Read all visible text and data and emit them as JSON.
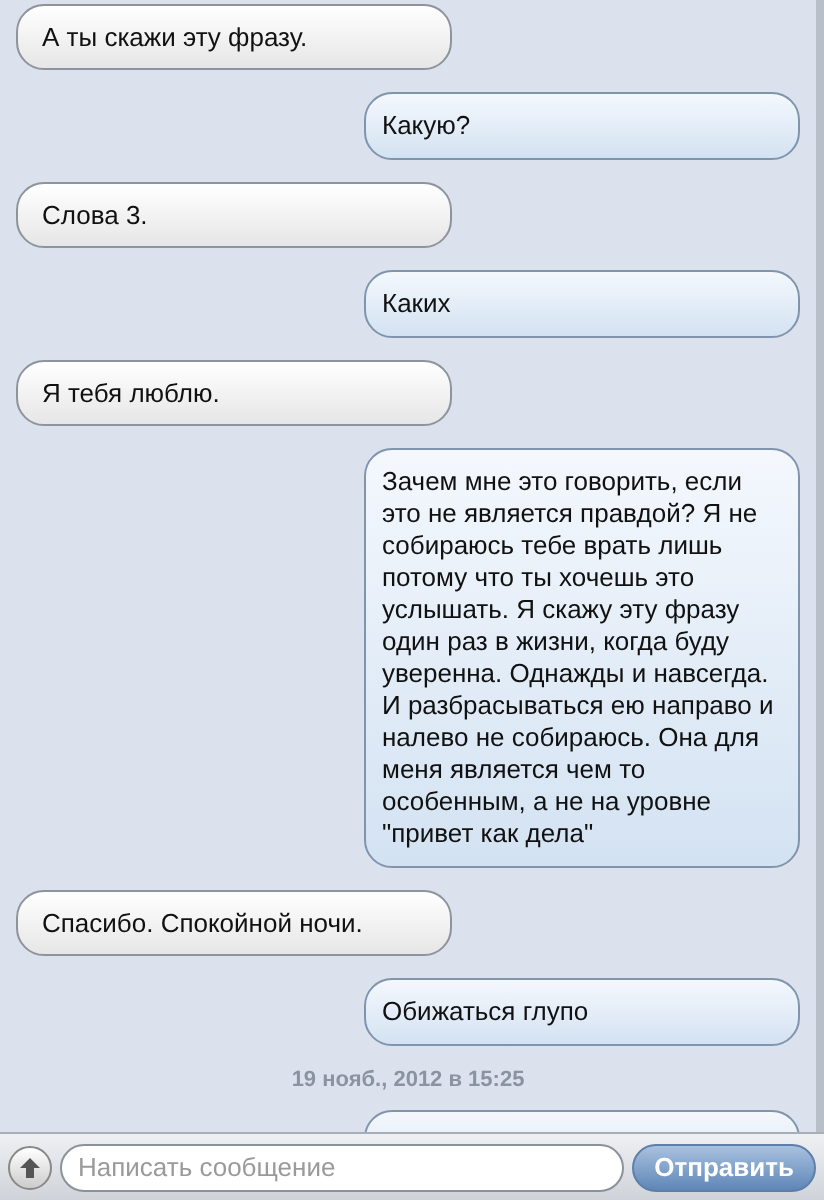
{
  "messages": [
    {
      "kind": "received",
      "text": "А ты скажи эту фразу."
    },
    {
      "kind": "sent",
      "text": "Какую?"
    },
    {
      "kind": "received",
      "text": "Слова 3."
    },
    {
      "kind": "sent",
      "text": "Каких"
    },
    {
      "kind": "received",
      "text": "Я тебя люблю."
    },
    {
      "kind": "sent",
      "text": "Зачем мне это говорить, если это не является правдой? Я не собираюсь тебе врать лишь потому что ты хочешь это услышать. Я скажу эту фразу один раз в жизни, когда буду уверенна. Однажды и навсегда. И разбрасываться ею направо и налево не собираюсь. Она для меня является чем то особенным, а не на уровне \"привет как дела\""
    },
    {
      "kind": "received",
      "text": "Спасибо. Спокойной ночи."
    },
    {
      "kind": "sent",
      "text": "Обижаться глупо"
    },
    {
      "kind": "timestamp",
      "text": "19 нояб., 2012 в 15:25"
    },
    {
      "kind": "sent_hidden"
    }
  ],
  "composer": {
    "placeholder": "Написать сообщение",
    "send_label": "Отправить"
  }
}
